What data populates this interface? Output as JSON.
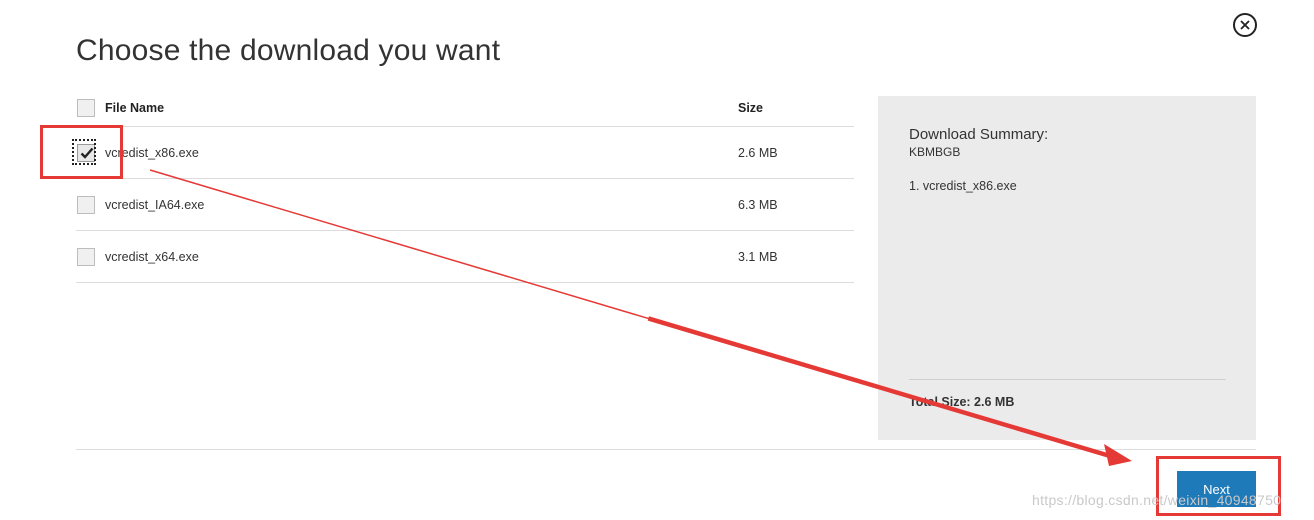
{
  "dialog": {
    "title": "Choose the download you want",
    "close_icon": "close-circle-icon"
  },
  "table": {
    "headers": {
      "name": "File Name",
      "size": "Size"
    },
    "rows": [
      {
        "name": "vcredist_x86.exe",
        "size": "2.6 MB",
        "checked": true
      },
      {
        "name": "vcredist_IA64.exe",
        "size": "6.3 MB",
        "checked": false
      },
      {
        "name": "vcredist_x64.exe",
        "size": "3.1 MB",
        "checked": false
      }
    ]
  },
  "summary": {
    "title": "Download Summary:",
    "size_line": "KBMBGB",
    "items": [
      "1. vcredist_x86.exe"
    ],
    "total": "Total Size: 2.6 MB"
  },
  "actions": {
    "next_label": "Next"
  },
  "watermark": "https://blog.csdn.net/weixin_40948750",
  "colors": {
    "accent": "#1e7ab8",
    "annotation": "#e53935",
    "summary_bg": "#ebebeb"
  }
}
